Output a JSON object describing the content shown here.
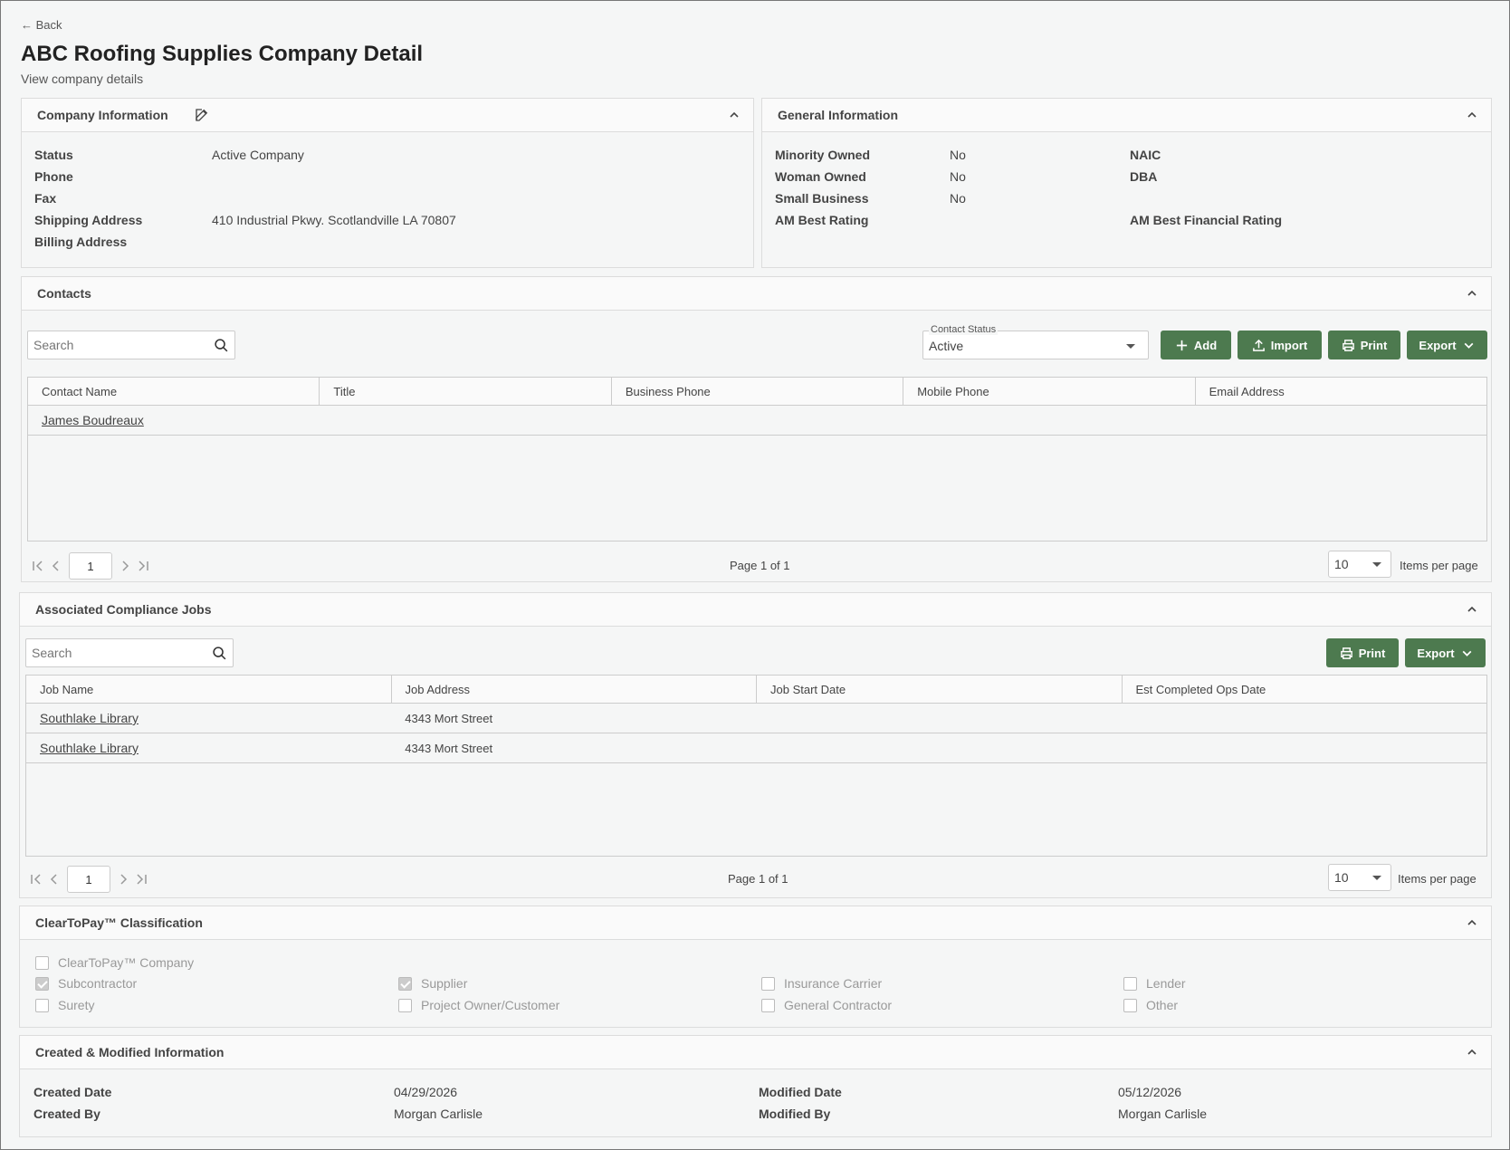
{
  "header": {
    "back_label": "← Back",
    "title": "ABC Roofing Supplies Company Detail",
    "subtitle": "View company details"
  },
  "company_info": {
    "heading": "Company Information",
    "fields": [
      {
        "label": "Status",
        "value": "Active Company"
      },
      {
        "label": "Phone",
        "value": ""
      },
      {
        "label": "Fax",
        "value": ""
      },
      {
        "label": "Shipping Address",
        "value": "410 Industrial Pkwy. Scotlandville LA 70807"
      },
      {
        "label": "Billing Address",
        "value": ""
      }
    ]
  },
  "general_info": {
    "heading": "General Information",
    "left": [
      {
        "label": "Minority Owned",
        "value": "No"
      },
      {
        "label": "Woman Owned",
        "value": "No"
      },
      {
        "label": "Small Business",
        "value": "No"
      },
      {
        "label": "AM Best Rating",
        "value": ""
      }
    ],
    "right": [
      {
        "label": "NAIC",
        "value": ""
      },
      {
        "label": "DBA",
        "value": ""
      },
      {
        "label": "AM Best Financial Rating",
        "value": ""
      }
    ]
  },
  "contacts": {
    "heading": "Contacts",
    "search_placeholder": "Search",
    "status_label": "Contact Status",
    "status_value": "Active",
    "add_label": "Add",
    "import_label": "Import",
    "print_label": "Print",
    "export_label": "Export",
    "columns": [
      "Contact Name",
      "Title",
      "Business Phone",
      "Mobile Phone",
      "Email Address"
    ],
    "rows": [
      {
        "name": "James Boudreaux",
        "title": "",
        "business_phone": "",
        "mobile_phone": "",
        "email": ""
      }
    ],
    "page": "1",
    "page_info": "Page 1 of 1",
    "per_page": "10",
    "per_page_label": "Items per page"
  },
  "jobs": {
    "heading": "Associated Compliance Jobs",
    "search_placeholder": "Search",
    "print_label": "Print",
    "export_label": "Export",
    "columns": [
      "Job Name",
      "Job Address",
      "Job Start Date",
      "Est Completed Ops Date"
    ],
    "rows": [
      {
        "name": "Southlake Library",
        "address": "4343 Mort Street",
        "start": "",
        "est": ""
      },
      {
        "name": "Southlake Library",
        "address": "4343 Mort Street",
        "start": "",
        "est": ""
      }
    ],
    "page": "1",
    "page_info": "Page 1 of 1",
    "per_page": "10",
    "per_page_label": "Items per page"
  },
  "classification": {
    "heading": "ClearToPay™ Classification",
    "items": [
      {
        "label": "ClearToPay™ Company",
        "checked": false
      },
      {
        "label": "Subcontractor",
        "checked": true
      },
      {
        "label": "Supplier",
        "checked": true
      },
      {
        "label": "Insurance Carrier",
        "checked": false
      },
      {
        "label": "Lender",
        "checked": false
      },
      {
        "label": "Surety",
        "checked": false
      },
      {
        "label": "Project Owner/Customer",
        "checked": false
      },
      {
        "label": "General Contractor",
        "checked": false
      },
      {
        "label": "Other",
        "checked": false
      }
    ]
  },
  "created_modified": {
    "heading": "Created & Modified Information",
    "created_date_label": "Created Date",
    "created_date": "04/29/2026",
    "created_by_label": "Created By",
    "created_by": "Morgan Carlisle",
    "modified_date_label": "Modified Date",
    "modified_date": "05/12/2026",
    "modified_by_label": "Modified By",
    "modified_by": "Morgan Carlisle"
  }
}
